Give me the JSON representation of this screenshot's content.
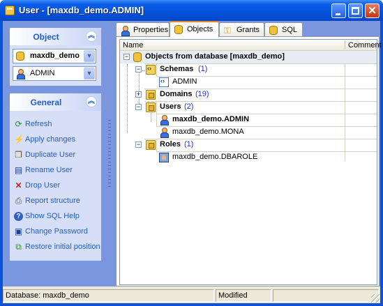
{
  "window": {
    "title": "User - [maxdb_demo.ADMIN]"
  },
  "object_panel": {
    "title": "Object",
    "database_combo": {
      "value": "maxdb_demo",
      "icon": "database-icon"
    },
    "user_combo": {
      "value": "ADMIN",
      "icon": "user-icon"
    }
  },
  "general_panel": {
    "title": "General",
    "items": [
      {
        "label": "Refresh",
        "icon": "refresh-icon"
      },
      {
        "label": "Apply changes",
        "icon": "apply-icon"
      },
      {
        "label": "Duplicate User",
        "icon": "duplicate-icon"
      },
      {
        "label": "Rename User",
        "icon": "rename-icon"
      },
      {
        "label": "Drop User",
        "icon": "drop-icon"
      },
      {
        "label": "Report structure",
        "icon": "printer-icon"
      },
      {
        "label": "Show SQL Help",
        "icon": "help-icon"
      },
      {
        "label": "Change Password",
        "icon": "password-icon"
      },
      {
        "label": "Restore initial position",
        "icon": "restore-icon"
      }
    ]
  },
  "tabs": [
    {
      "label": "Properties",
      "active": false
    },
    {
      "label": "Objects",
      "active": true
    },
    {
      "label": "Grants",
      "active": false
    },
    {
      "label": "SQL",
      "active": false
    }
  ],
  "grid": {
    "columns": [
      "Name",
      "Comment"
    ],
    "root": "Objects from database [maxdb_demo]",
    "groups": [
      {
        "label": "Schemas",
        "count": "(1)",
        "expanded": true,
        "children": [
          "ADMIN"
        ]
      },
      {
        "label": "Domains",
        "count": "(19)",
        "expanded": false,
        "children": []
      },
      {
        "label": "Users",
        "count": "(2)",
        "expanded": true,
        "children": [
          "maxdb_demo.ADMIN",
          "maxdb_demo.MONA"
        ]
      },
      {
        "label": "Roles",
        "count": "(1)",
        "expanded": true,
        "children": [
          "maxdb_demo.DBAROLE"
        ]
      }
    ]
  },
  "statusbar": {
    "database": "Database: maxdb_demo",
    "state": "Modified"
  },
  "colors": {
    "titlebar": "#0a52d8",
    "sidebar": "#7a96df",
    "link": "#215dc6",
    "active_tab_accent": "#e68b2c"
  }
}
